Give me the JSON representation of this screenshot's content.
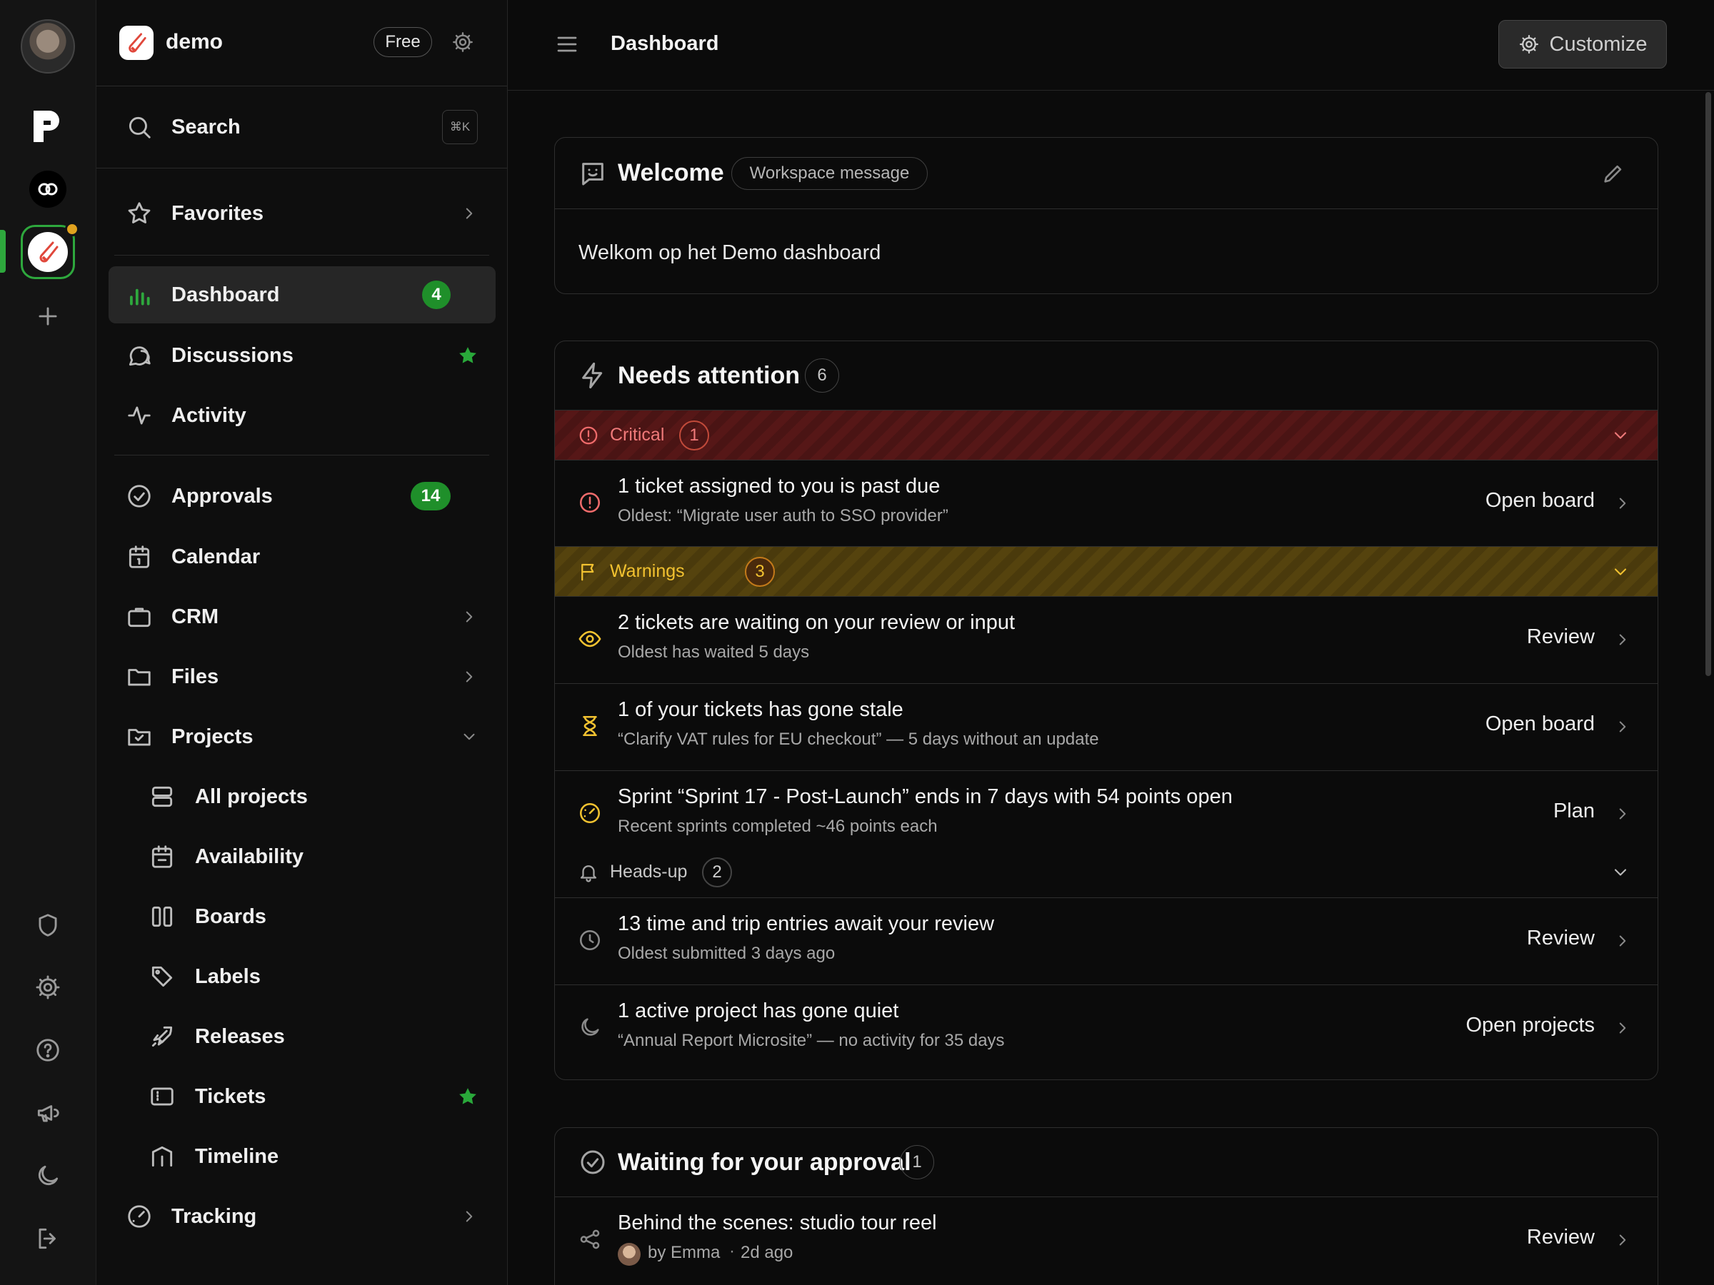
{
  "workspace": {
    "name": "demo",
    "plan": "Free"
  },
  "search": {
    "label": "Search",
    "shortcut": "⌘K"
  },
  "sidebar": {
    "favorites": "Favorites",
    "dashboard": {
      "label": "Dashboard",
      "count": "4"
    },
    "discussions": "Discussions",
    "activity": "Activity",
    "approvals": {
      "label": "Approvals",
      "count": "14"
    },
    "calendar": "Calendar",
    "crm": "CRM",
    "files": "Files",
    "projects": "Projects",
    "projects_sub": {
      "all": "All projects",
      "availability": "Availability",
      "boards": "Boards",
      "labels": "Labels",
      "releases": "Releases",
      "tickets": "Tickets",
      "timeline": "Timeline"
    },
    "tracking": "Tracking"
  },
  "header": {
    "title": "Dashboard",
    "customize": "Customize"
  },
  "welcome": {
    "title": "Welcome",
    "tag": "Workspace message",
    "message": "Welkom op het Demo dashboard"
  },
  "attention": {
    "title": "Needs attention",
    "count": "6",
    "critical": {
      "label": "Critical",
      "count": "1"
    },
    "warnings": {
      "label": "Warnings",
      "count": "3"
    },
    "headsup": {
      "label": "Heads-up",
      "count": "2"
    },
    "items": [
      {
        "title": "1 ticket assigned to you is past due",
        "sub": "Oldest: “Migrate user auth to SSO provider”",
        "action": "Open board"
      },
      {
        "title": "2 tickets are waiting on your review or input",
        "sub": "Oldest has waited 5 days",
        "action": "Review"
      },
      {
        "title": "1 of your tickets has gone stale",
        "sub": "“Clarify VAT rules for EU checkout” — 5 days without an update",
        "action": "Open board"
      },
      {
        "title": "Sprint “Sprint 17 - Post-Launch” ends in 7 days with 54 points open",
        "sub": "Recent sprints completed ~46 points each",
        "action": "Plan"
      },
      {
        "title": "13 time and trip entries await your review",
        "sub": "Oldest submitted 3 days ago",
        "action": "Review"
      },
      {
        "title": "1 active project has gone quiet",
        "sub": "“Annual Report Microsite” — no activity for 35 days",
        "action": "Open projects"
      }
    ]
  },
  "approval": {
    "title": "Waiting for your approval",
    "count": "1",
    "item": {
      "title": "Behind the scenes: studio tour reel",
      "by": "by Emma",
      "when": "2d ago",
      "action": "Review"
    }
  },
  "colors": {
    "accent": "#1f8f2a",
    "critical": "#ef6b6b",
    "warning": "#f2c230"
  }
}
